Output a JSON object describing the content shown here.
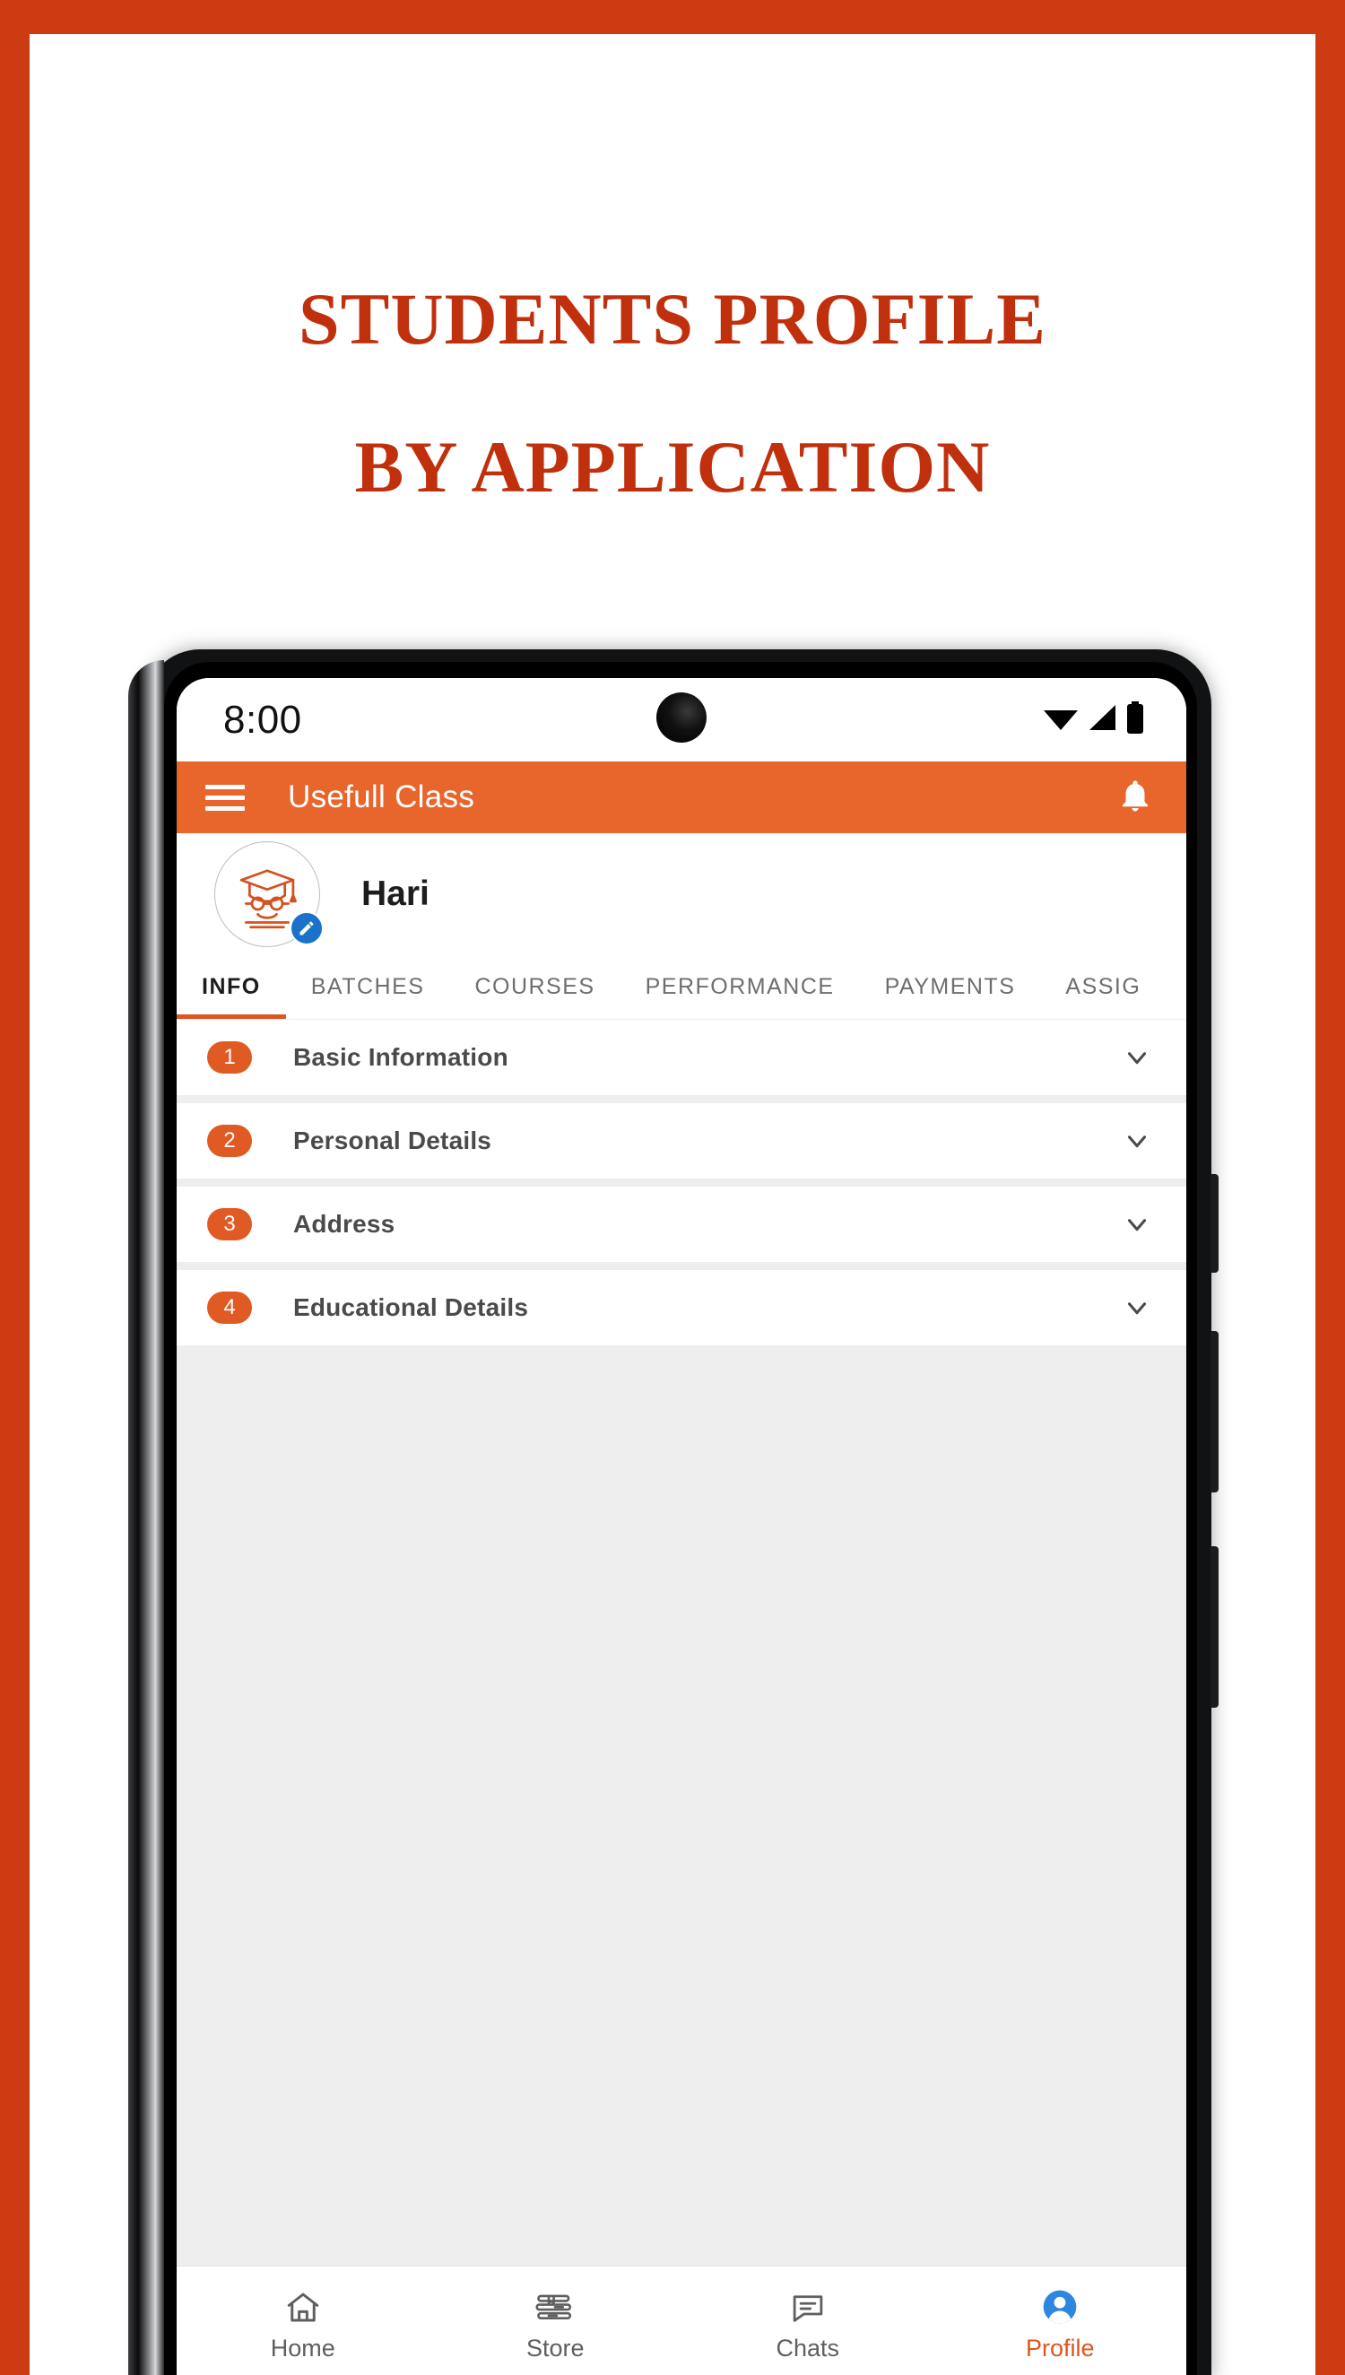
{
  "poster": {
    "background_color": "#cc3b11",
    "card_color": "#ffffff",
    "headline_color": "#c0300d",
    "headline_line1": "STUDENTS PROFILE",
    "headline_line2": "BY APPLICATION"
  },
  "phone": {
    "status_bar": {
      "time": "8:00",
      "icons": [
        "wifi-icon",
        "signal-icon",
        "battery-icon"
      ]
    },
    "app_bar": {
      "menu_icon": "hamburger-menu-icon",
      "title": "Usefull Class",
      "notification_icon": "bell-icon",
      "background_color": "#e8652b"
    },
    "profile": {
      "avatar_icon": "graduate-avatar-icon",
      "edit_icon": "pencil-icon",
      "name": "Hari"
    },
    "tabs": [
      {
        "label": "INFO",
        "active": true
      },
      {
        "label": "BATCHES",
        "active": false
      },
      {
        "label": "COURSES",
        "active": false
      },
      {
        "label": "PERFORMANCE",
        "active": false
      },
      {
        "label": "PAYMENTS",
        "active": false
      },
      {
        "label": "ASSIG",
        "active": false
      }
    ],
    "accordion": [
      {
        "number": "1",
        "label": "Basic Information",
        "expand_icon": "chevron-down-icon"
      },
      {
        "number": "2",
        "label": "Personal Details",
        "expand_icon": "chevron-down-icon"
      },
      {
        "number": "3",
        "label": "Address",
        "expand_icon": "chevron-down-icon"
      },
      {
        "number": "4",
        "label": "Educational Details",
        "expand_icon": "chevron-down-icon"
      }
    ],
    "bottom_nav": [
      {
        "label": "Home",
        "icon": "home-icon",
        "active": false
      },
      {
        "label": "Store",
        "icon": "books-icon",
        "active": false
      },
      {
        "label": "Chats",
        "icon": "chat-bubble-icon",
        "active": false
      },
      {
        "label": "Profile",
        "icon": "person-icon",
        "active": true
      }
    ],
    "accent_color": "#e0551f"
  }
}
